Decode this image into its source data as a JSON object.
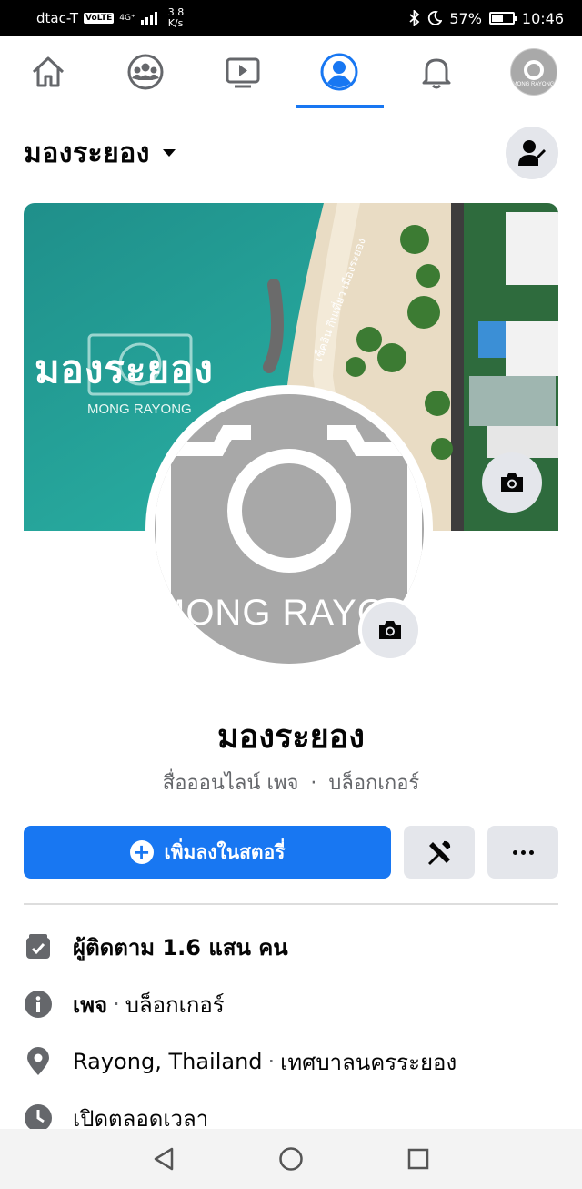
{
  "status_bar": {
    "carrier": "dtac-T",
    "volte": "VoLTE",
    "network": "4G⁺",
    "speed_value": "3.8",
    "speed_unit": "K/s",
    "battery_text": "57%",
    "battery_level": 0.57,
    "time": "10:46"
  },
  "nav": {
    "tabs": [
      {
        "name": "home",
        "icon": "home-icon"
      },
      {
        "name": "groups",
        "icon": "groups-icon"
      },
      {
        "name": "watch",
        "icon": "video-icon"
      },
      {
        "name": "profile",
        "icon": "profile-icon",
        "active": true
      },
      {
        "name": "notifications",
        "icon": "bell-icon"
      },
      {
        "name": "menu",
        "icon": "avatar"
      }
    ],
    "avatar_text": "MONG RAYONG"
  },
  "header": {
    "title": "มองระยอง"
  },
  "cover": {
    "logo_text": "มองระยอง",
    "logo_sub": "MONG RAYONG",
    "tagline": "เช็คอิน กินเที่ยว เมืองระยอง"
  },
  "profile": {
    "pic_text": "MONG RAYONG",
    "name": "มองระยอง",
    "category_1": "สื่อออนไลน์ เพจ",
    "category_sep": "·",
    "category_2": "บล็อกเกอร์"
  },
  "actions": {
    "primary_label": "เพิ่มลงในสตอรี่",
    "plus_glyph": "+"
  },
  "info": {
    "followers": "ผู้ติดตาม 1.6 แสน คน",
    "page_label": "เพจ",
    "sep": "·",
    "page_type": "บล็อกเกอร์",
    "location": "Rayong, Thailand",
    "location_detail": "เทศบาลนครระยอง",
    "hours": "เปิดตลอดเวลา"
  },
  "colors": {
    "accent": "#1877f2",
    "button_gray": "#e4e6eb",
    "secondary_text": "#65676b"
  }
}
